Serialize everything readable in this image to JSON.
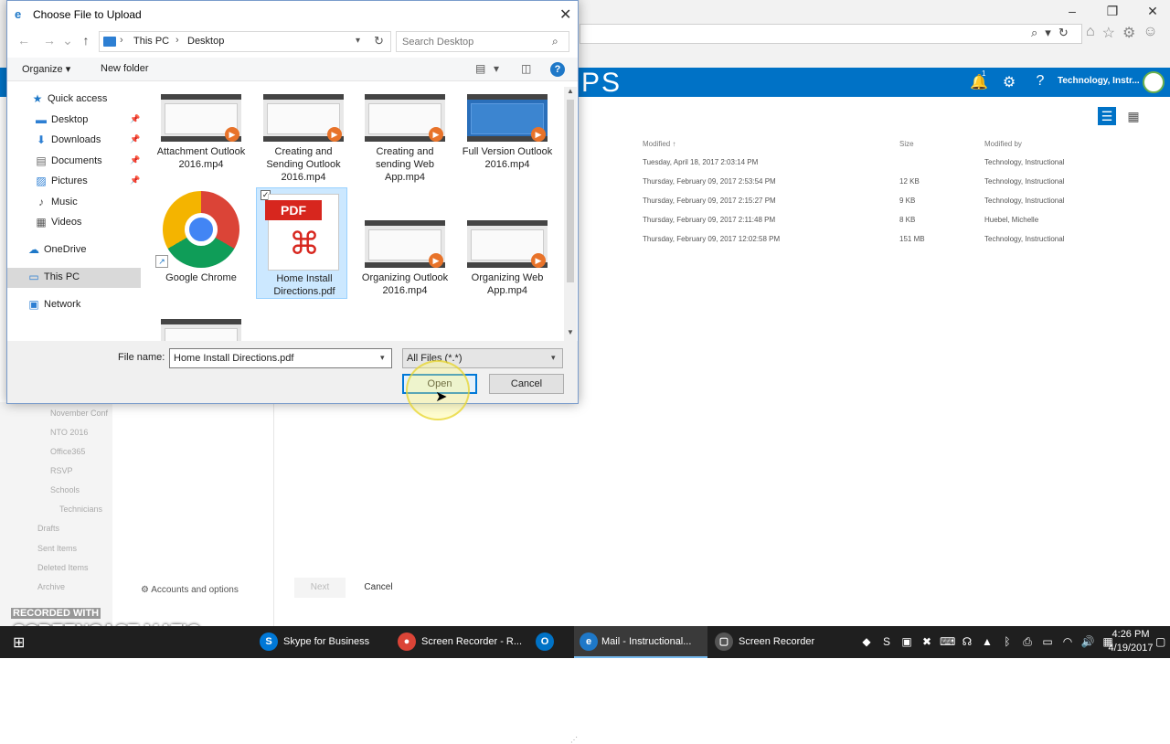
{
  "dialog": {
    "title": "Choose File to Upload",
    "breadcrumb": [
      "This PC",
      "Desktop"
    ],
    "search_placeholder": "Search Desktop",
    "toolbar": {
      "organize": "Organize",
      "new_folder": "New folder"
    },
    "nav_items": [
      {
        "label": "Quick access",
        "icon": "star-icon",
        "pinned": false
      },
      {
        "label": "Desktop",
        "icon": "desktop-icon",
        "pinned": true
      },
      {
        "label": "Downloads",
        "icon": "download-icon",
        "pinned": true
      },
      {
        "label": "Documents",
        "icon": "documents-icon",
        "pinned": true
      },
      {
        "label": "Pictures",
        "icon": "pictures-icon",
        "pinned": true
      },
      {
        "label": "Music",
        "icon": "music-icon",
        "pinned": false
      },
      {
        "label": "Videos",
        "icon": "videos-icon",
        "pinned": false
      },
      {
        "label": "OneDrive",
        "icon": "cloud-icon",
        "pinned": false
      },
      {
        "label": "This PC",
        "icon": "computer-icon",
        "pinned": false
      },
      {
        "label": "Network",
        "icon": "network-icon",
        "pinned": false
      }
    ],
    "selected_nav": "This PC",
    "files": [
      {
        "name": "Attachment Outlook 2016.mp4",
        "type": "video"
      },
      {
        "name": "Creating and Sending Outlook 2016.mp4",
        "type": "video"
      },
      {
        "name": "Creating and sending Web App.mp4",
        "type": "video"
      },
      {
        "name": "Full Version Outlook 2016.mp4",
        "type": "video"
      },
      {
        "name": "Google Chrome",
        "type": "shortcut"
      },
      {
        "name": "Home Install Directions.pdf",
        "type": "pdf",
        "selected": true
      },
      {
        "name": "Organizing Outlook 2016.mp4",
        "type": "video"
      },
      {
        "name": "Organizing Web App.mp4",
        "type": "video"
      }
    ],
    "file_name_label": "File name:",
    "file_name_value": "Home Install Directions.pdf",
    "file_type": "All Files (*.*)",
    "open_label": "Open",
    "cancel_label": "Cancel"
  },
  "app": {
    "brand": "PS",
    "notification_count": "1",
    "user": "Technology, Instr...",
    "columns": {
      "modified": "Modified",
      "size": "Size",
      "modified_by": "Modified by"
    },
    "rows": [
      {
        "modified": "Tuesday, April 18, 2017 2:03:14 PM",
        "size": "",
        "by": "Technology, Instructional"
      },
      {
        "modified": "Thursday, February 09, 2017 2:53:54 PM",
        "size": "12 KB",
        "by": "Technology, Instructional"
      },
      {
        "modified": "Thursday, February 09, 2017 2:15:27 PM",
        "size": "9 KB",
        "by": "Technology, Instructional"
      },
      {
        "modified": "Thursday, February 09, 2017 2:11:48 PM",
        "size": "8 KB",
        "by": "Huebel, Michelle"
      },
      {
        "modified": "Thursday, February 09, 2017 12:02:58 PM",
        "size": "151 MB",
        "by": "Technology, Instructional"
      }
    ],
    "left_folders": [
      "November Conf",
      "NTO 2016",
      "Office365",
      "RSVP",
      "Schools",
      "Technicians",
      "Drafts",
      "Sent Items",
      "Deleted Items",
      "Archive"
    ],
    "accounts": "Accounts and options",
    "next": "Next",
    "cancel": "Cancel"
  },
  "watermark": {
    "top": "RECORDED WITH",
    "main": "SCREENCAST MATIC"
  },
  "taskbar": {
    "tasks": [
      {
        "label": "Skype for Business",
        "icon": "skype-icon",
        "color": "#0078d7"
      },
      {
        "label": "Screen Recorder - R...",
        "icon": "chrome-icon",
        "color": "#db4437"
      },
      {
        "label": "",
        "icon": "outlook-icon",
        "color": "#0072c6"
      },
      {
        "label": "Mail - Instructional...",
        "icon": "ie-icon",
        "color": "#1e78c8"
      },
      {
        "label": "Screen Recorder",
        "icon": "recorder-icon",
        "color": "#555555"
      }
    ],
    "time": "4:26 PM",
    "date": "4/19/2017"
  },
  "colors": {
    "accent": "#0072c6",
    "selection": "#cce8ff"
  }
}
